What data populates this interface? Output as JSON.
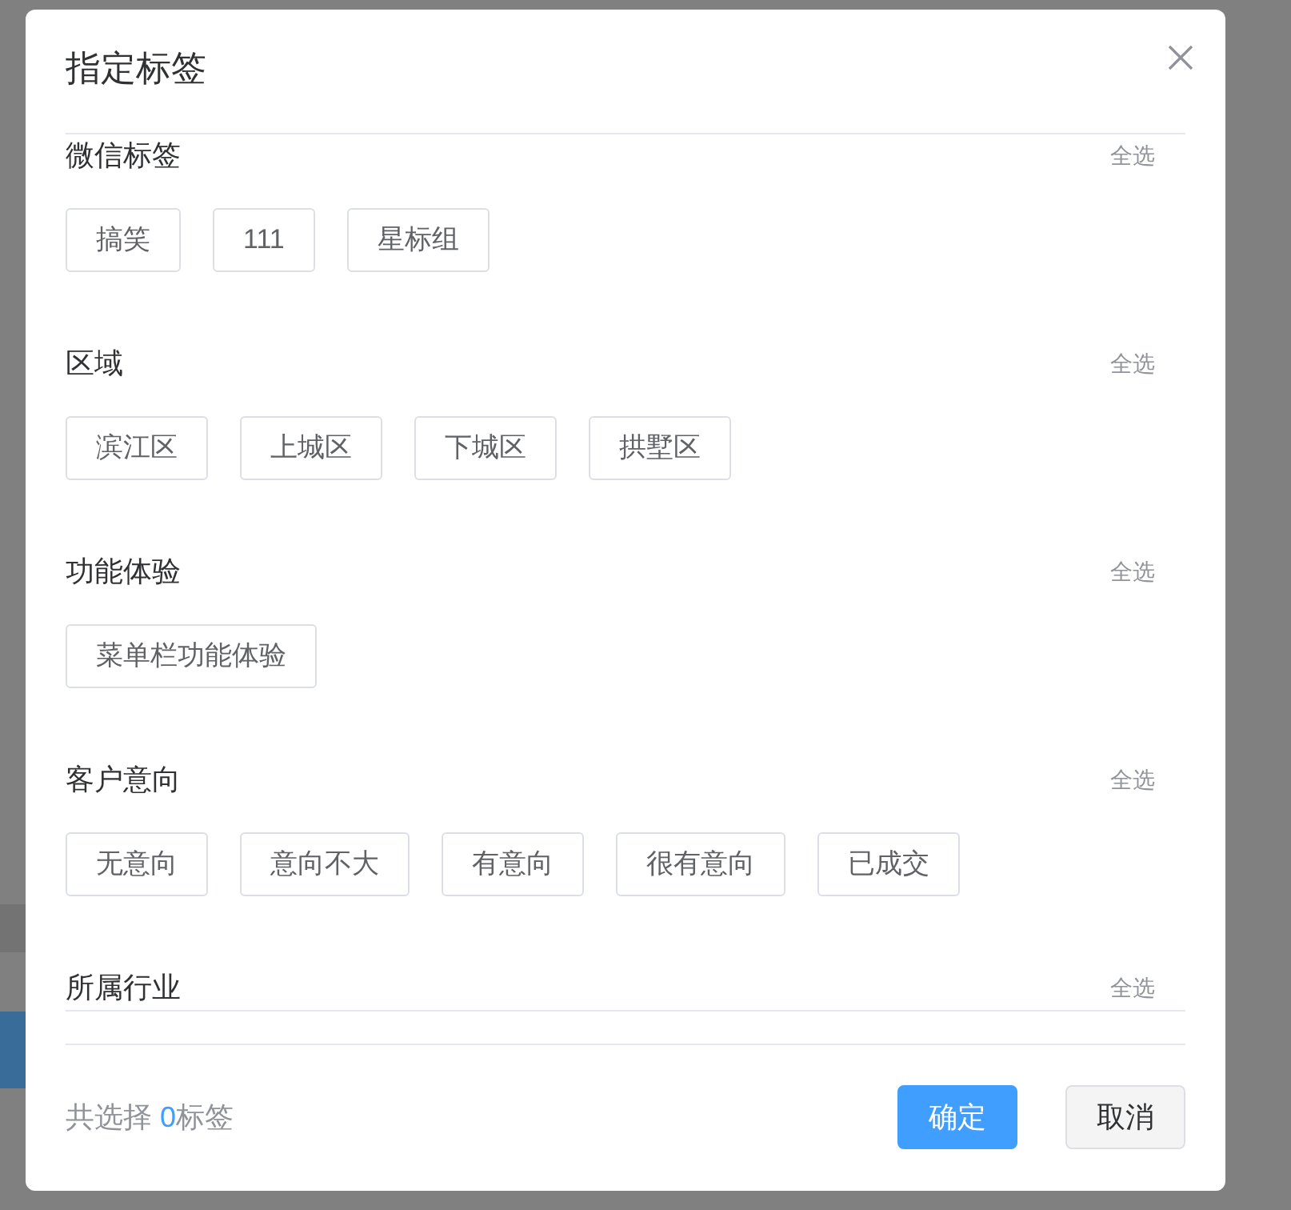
{
  "dialog": {
    "title": "指定标签"
  },
  "sections": [
    {
      "title": "微信标签",
      "select_all": "全选",
      "tags": [
        "搞笑",
        "111",
        "星标组"
      ]
    },
    {
      "title": "区域",
      "select_all": "全选",
      "tags": [
        "滨江区",
        "上城区",
        "下城区",
        "拱墅区"
      ]
    },
    {
      "title": "功能体验",
      "select_all": "全选",
      "tags": [
        "菜单栏功能体验"
      ]
    },
    {
      "title": "客户意向",
      "select_all": "全选",
      "tags": [
        "无意向",
        "意向不大",
        "有意向",
        "很有意向",
        "已成交"
      ]
    },
    {
      "title": "所属行业",
      "select_all": "全选"
    }
  ],
  "footer": {
    "summary_prefix": "共选择 ",
    "count": "0",
    "summary_suffix": "标签"
  },
  "buttons": [
    {
      "label": "确定",
      "kind": "primary"
    },
    {
      "label": "取消",
      "kind": "default"
    }
  ]
}
